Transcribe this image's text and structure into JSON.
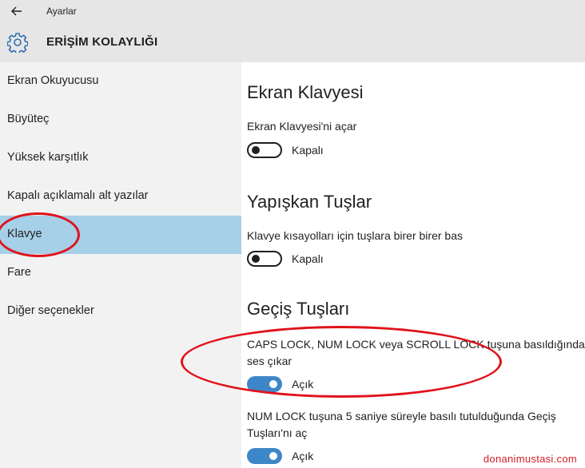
{
  "window": {
    "app_title": "Ayarlar",
    "page_title": "ERİŞİM KOLAYLIĞI"
  },
  "sidebar": {
    "items": [
      {
        "label": "Ekran Okuyucusu",
        "selected": false
      },
      {
        "label": "Büyüteç",
        "selected": false
      },
      {
        "label": "Yüksek karşıtlık",
        "selected": false
      },
      {
        "label": "Kapalı açıklamalı alt yazılar",
        "selected": false
      },
      {
        "label": "Klavye",
        "selected": true
      },
      {
        "label": "Fare",
        "selected": false
      },
      {
        "label": "Diğer seçenekler",
        "selected": false
      }
    ]
  },
  "main": {
    "on_screen_keyboard": {
      "title": "Ekran Klavyesi",
      "desc": "Ekran Klavyesi'ni açar",
      "state": "Kapalı"
    },
    "sticky_keys": {
      "title": "Yapışkan Tuşlar",
      "desc": "Klavye kısayolları için tuşlara birer birer bas",
      "state": "Kapalı"
    },
    "toggle_keys": {
      "title": "Geçiş Tuşları",
      "option1": {
        "desc_line1": "CAPS LOCK, NUM LOCK veya SCROLL LOCK tuşuna basıldığında",
        "desc_line2": "ses çıkar",
        "state": "Açık"
      },
      "option2": {
        "desc_line1": "NUM LOCK tuşuna 5 saniye süreyle basılı tutulduğunda Geçiş",
        "desc_line2": "Tuşları'nı aç",
        "state": "Açık"
      }
    }
  },
  "watermark": "donanimustasi.com",
  "colors": {
    "accent": "#3d87c8",
    "selection": "#a6cfe8",
    "annotation": "#e0121a"
  },
  "icons": [
    "back-arrow-icon",
    "gear-icon"
  ]
}
